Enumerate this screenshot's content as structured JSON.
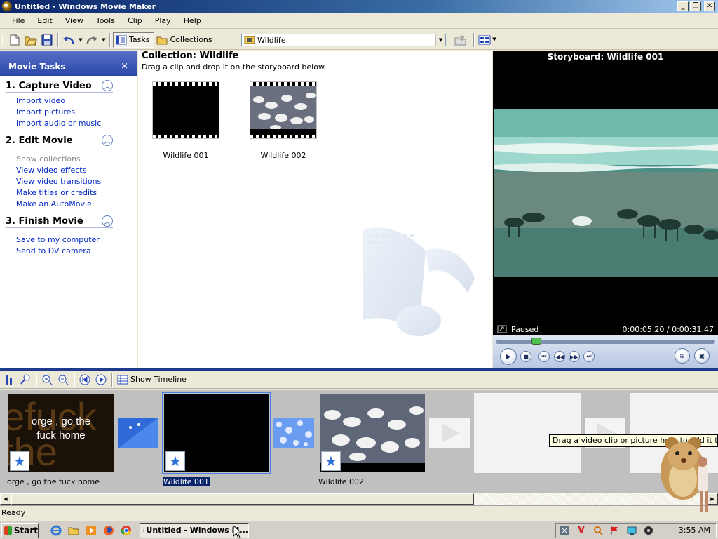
{
  "window": {
    "title": "Untitled - Windows Movie Maker"
  },
  "menu": [
    "File",
    "Edit",
    "View",
    "Tools",
    "Clip",
    "Play",
    "Help"
  ],
  "toolbar": {
    "tasks_label": "Tasks",
    "collections_label": "Collections",
    "collection_value": "Wildlife"
  },
  "tasks": {
    "header": "Movie Tasks",
    "close_glyph": "×",
    "sections": [
      {
        "title": "1. Capture Video",
        "links": [
          "Import video",
          "Import pictures",
          "Import audio or music"
        ]
      },
      {
        "title": "2. Edit Movie",
        "links": [
          "Show collections",
          "View video effects",
          "View video transitions",
          "Make titles or credits",
          "Make an AutoMovie"
        ]
      },
      {
        "title": "3. Finish Movie",
        "links": [
          "Save to my computer",
          "Send to DV camera"
        ]
      }
    ]
  },
  "collection": {
    "title": "Collection: Wildlife",
    "subtitle": "Drag a clip and drop it on the storyboard below.",
    "clips": [
      {
        "name": "Wildlife 001"
      },
      {
        "name": "Wildlife 002"
      }
    ]
  },
  "preview": {
    "title": "Storyboard: Wildlife 001",
    "status": "Paused",
    "time": "0:00:05.20 / 0:00:31.47",
    "progress": 0.17
  },
  "storyboard_toolbar": {
    "show_timeline": "Show Timeline"
  },
  "storyboard": {
    "clips": [
      {
        "name": "orge , go the fuck home",
        "overlay_line1": "orge , go the",
        "overlay_line2": "fuck home",
        "bg_text": "efuck the"
      },
      {
        "name": "Wildlife 001"
      },
      {
        "name": "Wildlife 002"
      }
    ],
    "tooltip": "Drag a video clip or picture here to add it to your r"
  },
  "status": "Ready",
  "taskbar": {
    "start": "Start",
    "task": "Untitled - Windows M...",
    "clock": "3:55 AM"
  },
  "colors": {
    "accent": "#2a48a8",
    "selection": "#0a246a",
    "link": "#0026c8"
  }
}
